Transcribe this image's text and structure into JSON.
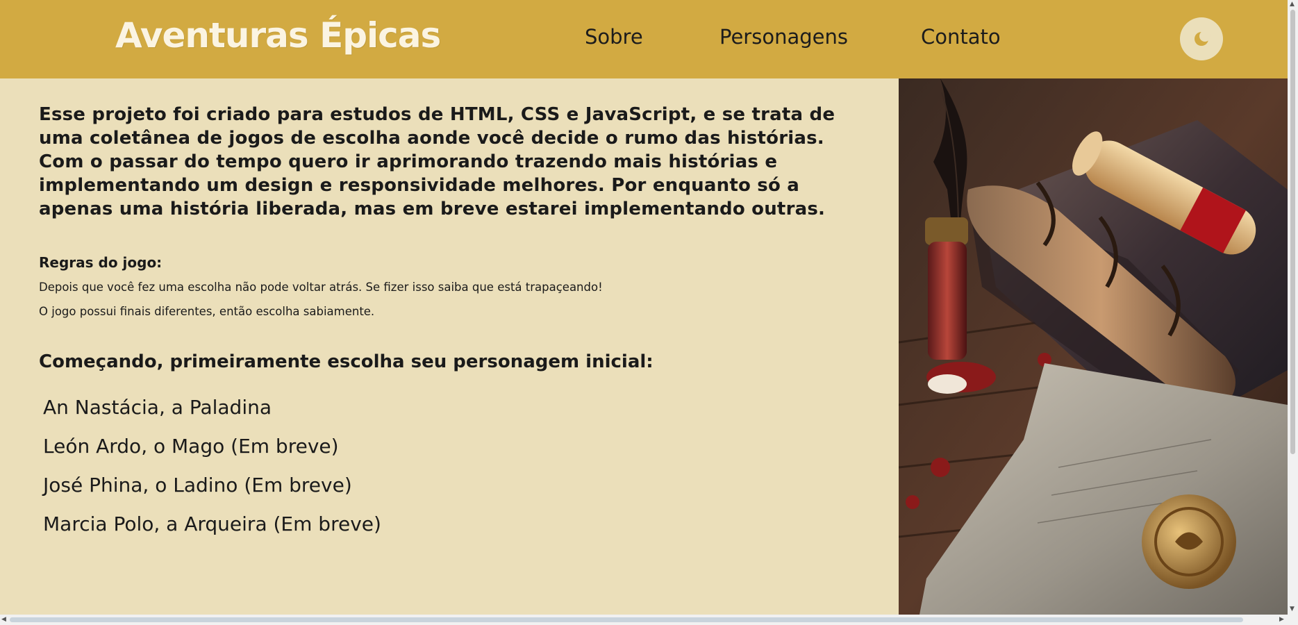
{
  "header": {
    "logo": "Aventuras Épicas",
    "nav": [
      "Sobre",
      "Personagens",
      "Contato"
    ],
    "theme_toggle_icon": "moon-icon"
  },
  "main": {
    "intro": "Esse projeto foi criado para estudos de HTML, CSS e JavaScript, e se trata de uma coletânea de jogos de escolha aonde você decide o rumo das histórias. Com o passar do tempo quero ir aprimorando trazendo mais histórias e implementando um design e responsividade melhores. Por enquanto só a apenas uma história liberada, mas em breve estarei implementando outras.",
    "rules_title": "Regras do jogo:",
    "rules": [
      "Depois que você fez uma escolha não pode voltar atrás. Se fizer isso saiba que está trapaçeando!",
      "O jogo possui finais diferentes, então escolha sabiamente."
    ],
    "start_title": "Começando, primeiramente escolha seu personagem inicial:",
    "characters": [
      "An Nastácia, a Paladina",
      "León Ardo, o Mago (Em breve)",
      "José Phina, o Ladino (Em breve)",
      "Marcia Polo, a Arqueira (Em breve)"
    ]
  },
  "colors": {
    "header_bg": "#d2aa42",
    "page_bg": "#ebdfba",
    "logo_text": "#fbf4e2",
    "text": "#1a1a1a"
  },
  "decor": {
    "hero_image": "illustration of quill pen, ink bottle, old book, scroll and wax-sealed letter on wooden table"
  }
}
